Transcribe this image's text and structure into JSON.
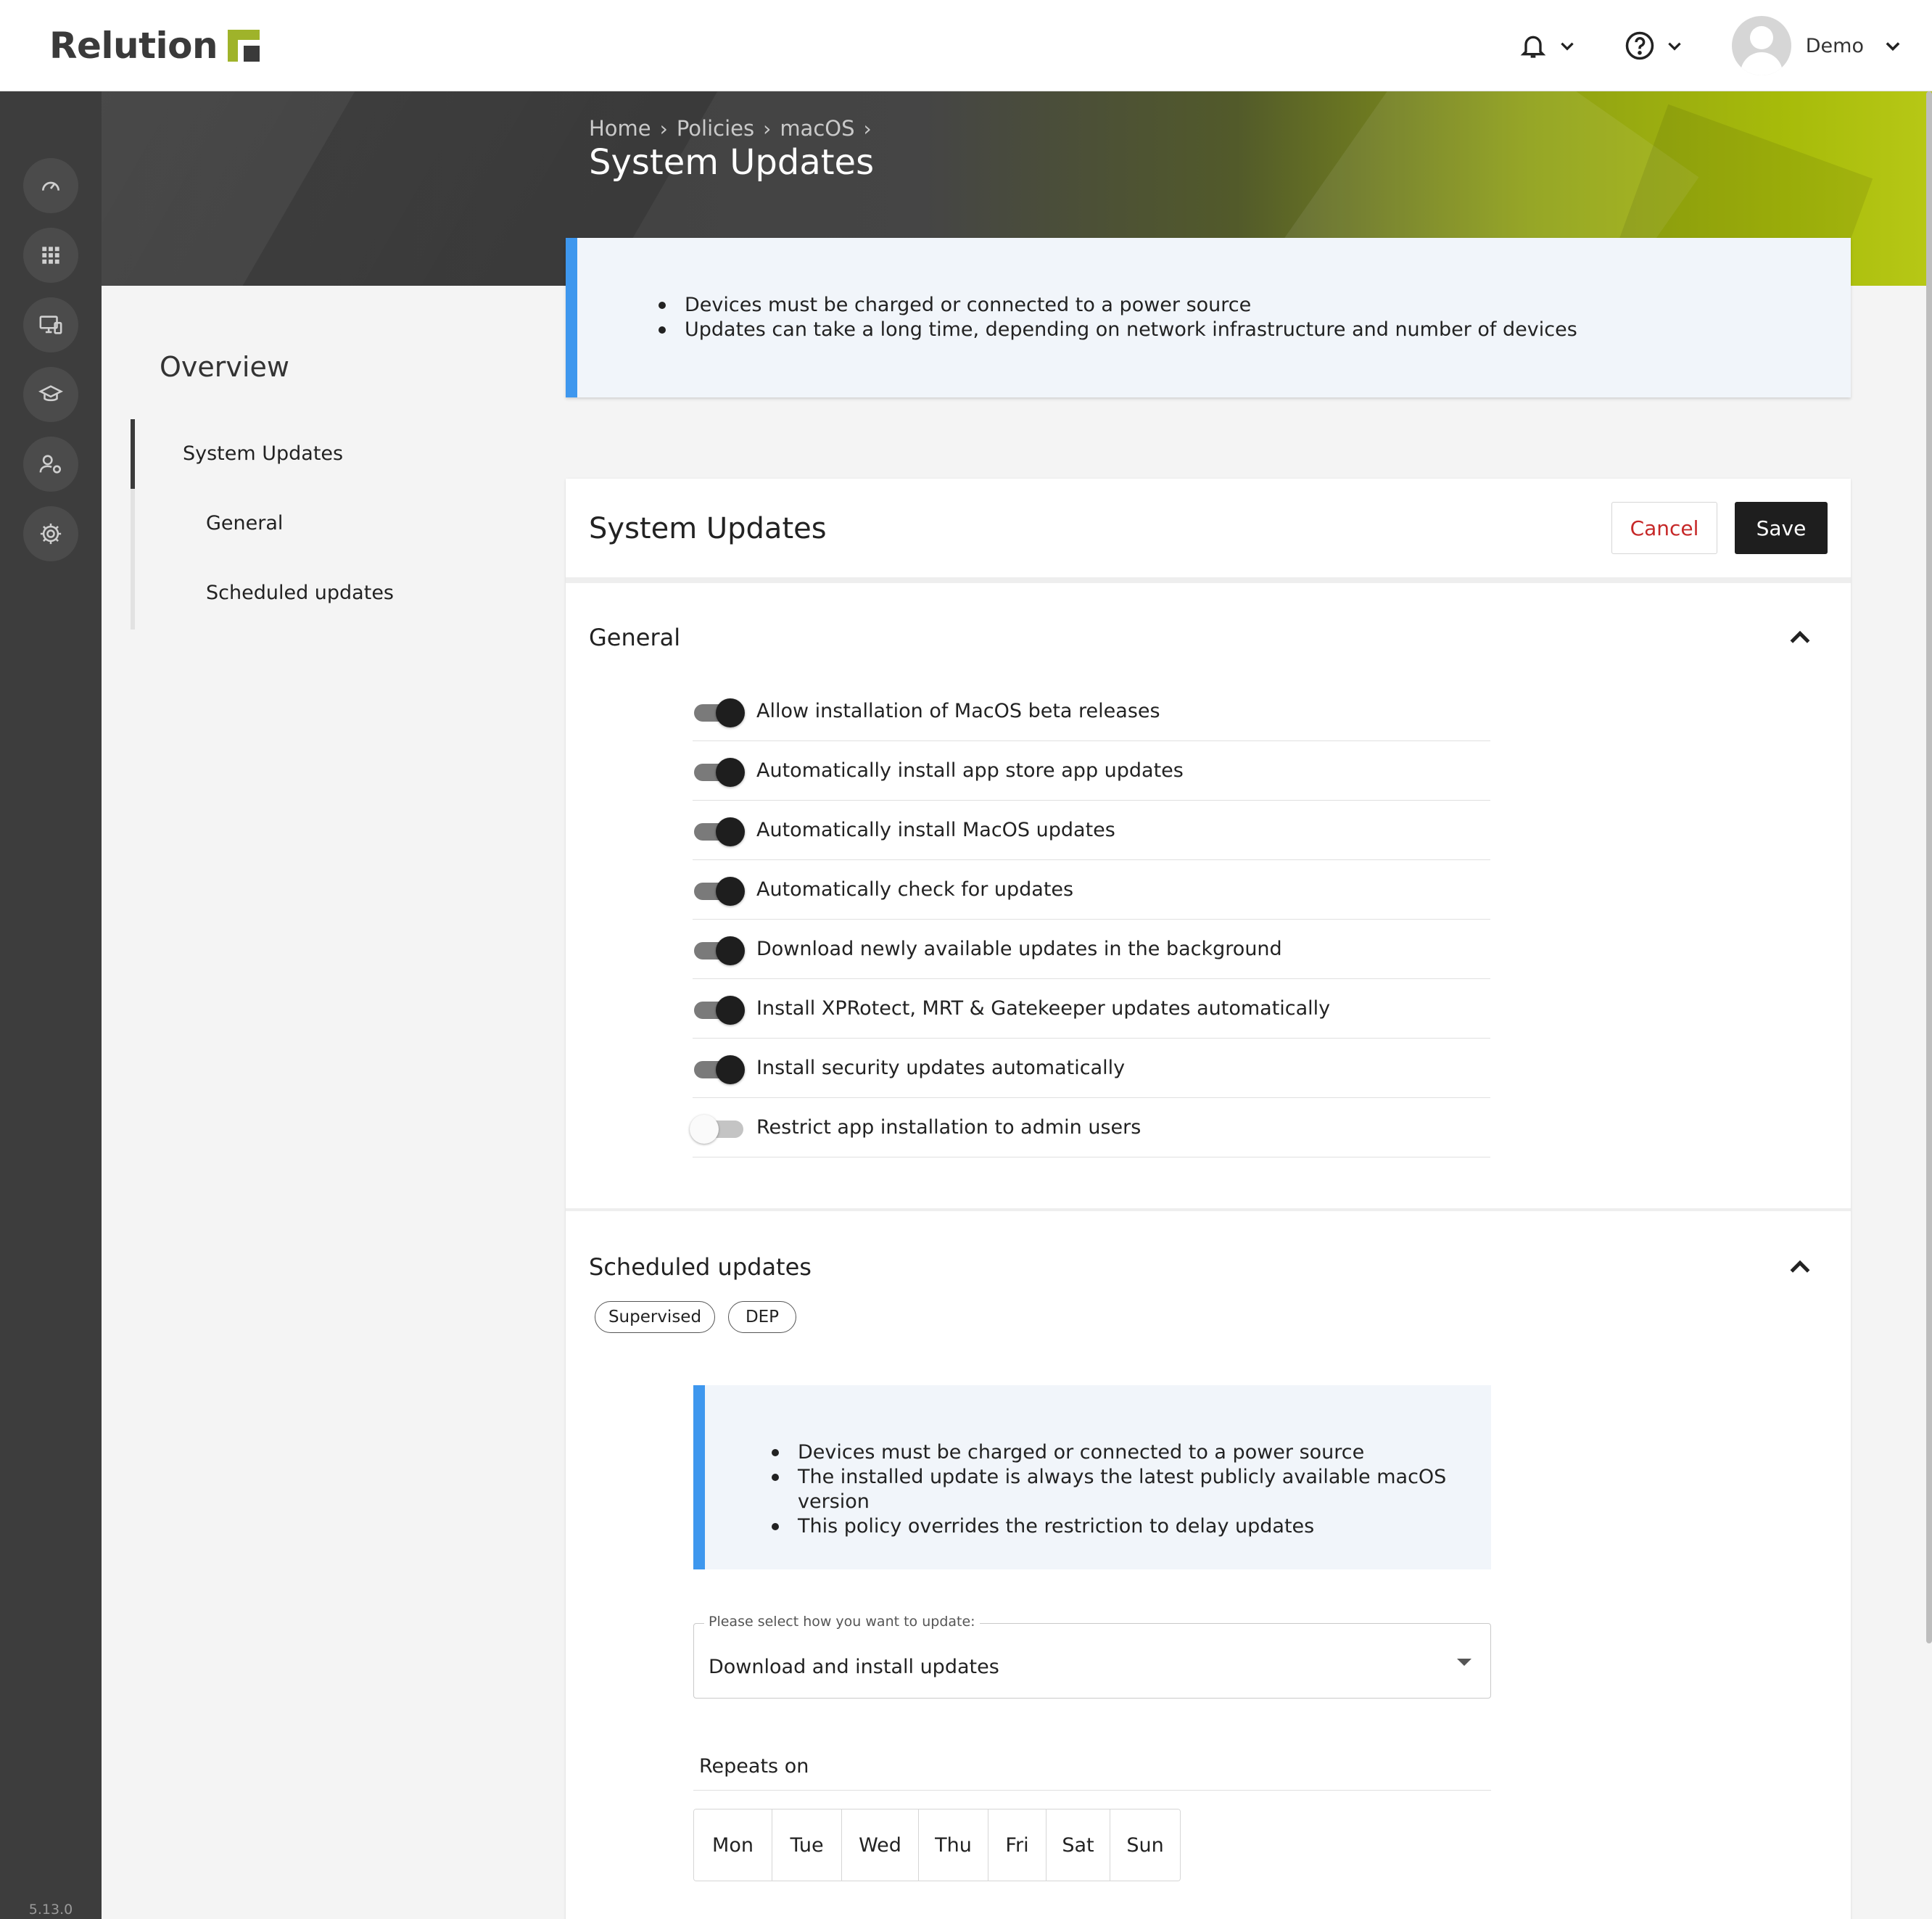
{
  "app": {
    "logo_text": "Relution",
    "version": "5.13.0"
  },
  "header": {
    "icons": [
      "bell-icon",
      "help-icon",
      "chevron-down-icon"
    ],
    "user_name": "Demo"
  },
  "rail": {
    "icons": [
      "dashboard-icon",
      "apps-grid-icon",
      "devices-icon",
      "education-icon",
      "users-settings-icon",
      "settings-gear-icon"
    ]
  },
  "breadcrumb": {
    "items": [
      "Home",
      "Policies",
      "macOS"
    ]
  },
  "page_title": "System Updates",
  "top_notice": {
    "items": [
      "Devices must be charged or connected to a power source",
      "Updates can take a long time, depending on network infrastructure and number of devices"
    ]
  },
  "sidenav": {
    "title": "Overview",
    "items": [
      {
        "label": "System Updates",
        "active": true
      },
      {
        "label": "General",
        "active": false
      },
      {
        "label": "Scheduled updates",
        "active": false
      }
    ]
  },
  "card": {
    "title": "System Updates",
    "cancel_label": "Cancel",
    "save_label": "Save"
  },
  "general": {
    "title": "General",
    "toggles": [
      {
        "label": "Allow installation of MacOS beta releases",
        "on": true
      },
      {
        "label": "Automatically install app store app updates",
        "on": true
      },
      {
        "label": "Automatically install MacOS updates",
        "on": true
      },
      {
        "label": "Automatically check for updates",
        "on": true
      },
      {
        "label": "Download newly available updates in the background",
        "on": true
      },
      {
        "label": "Install XPRotect, MRT & Gatekeeper updates automatically",
        "on": true
      },
      {
        "label": "Install security updates automatically",
        "on": true
      },
      {
        "label": "Restrict app installation to admin users",
        "on": false
      }
    ]
  },
  "scheduled": {
    "title": "Scheduled updates",
    "chips": [
      "Supervised",
      "DEP"
    ],
    "notice": [
      "Devices must be charged or connected to a power source",
      "The installed update is always the latest publicly available macOS version",
      "This policy overrides the restriction to delay updates"
    ],
    "select_legend": "Please select how you want to update:",
    "select_value": "Download and install updates",
    "repeats_label": "Repeats on",
    "days": [
      "Mon",
      "Tue",
      "Wed",
      "Thu",
      "Fri",
      "Sat",
      "Sun"
    ]
  },
  "colors": {
    "accent_blue": "#3e97ee",
    "brand_green": "#9fb32a",
    "danger_red": "#c62828",
    "dark": "#1e1e1e"
  }
}
